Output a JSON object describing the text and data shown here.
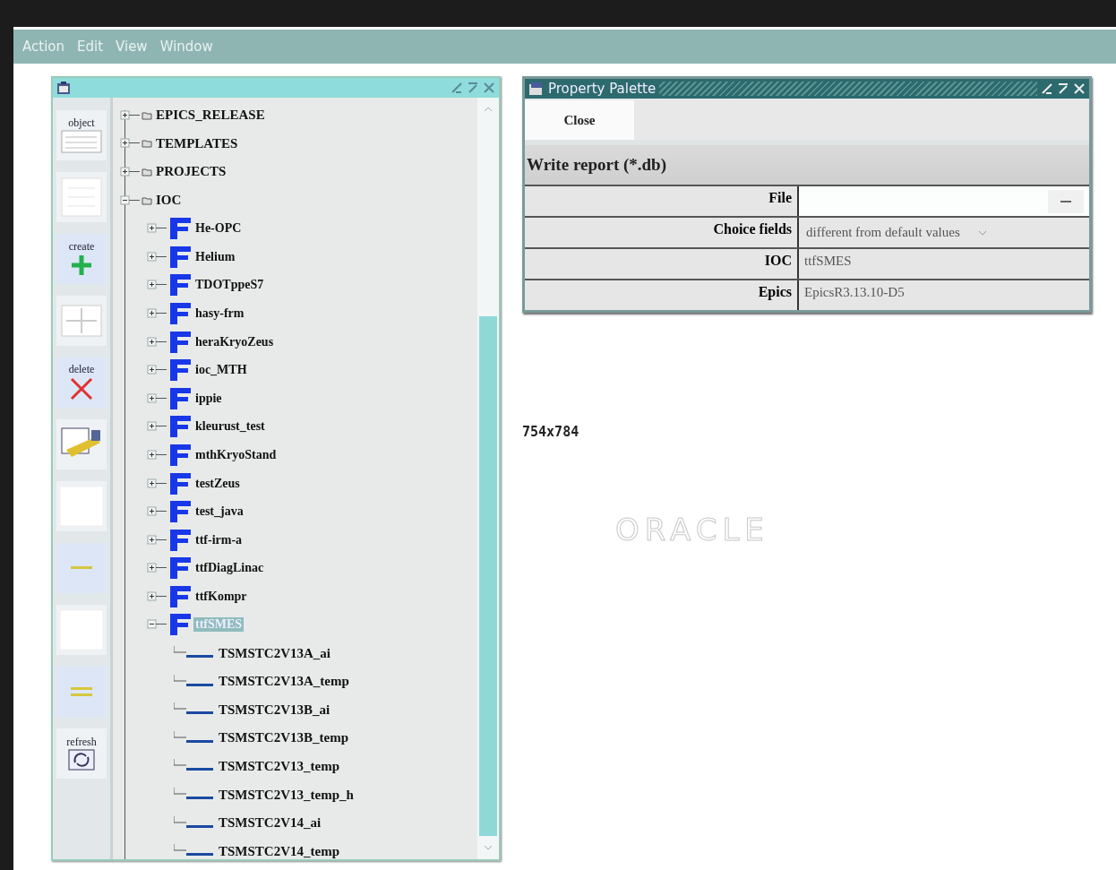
{
  "menu": [
    "Action",
    "Edit",
    "View",
    "Window"
  ],
  "navigator": {
    "toolbar": [
      {
        "kind": "list",
        "label": "object"
      },
      {
        "kind": "sheet"
      },
      {
        "kind": "create",
        "label": "create"
      },
      {
        "kind": "grid"
      },
      {
        "kind": "delete",
        "label": "delete"
      },
      {
        "kind": "report"
      },
      {
        "kind": "blank"
      },
      {
        "kind": "dash"
      },
      {
        "kind": "blank"
      },
      {
        "kind": "equal"
      },
      {
        "kind": "refresh",
        "label": "refresh"
      }
    ],
    "tree": [
      {
        "kind": "folder",
        "label": "EPICS_RELEASE",
        "expanded": false,
        "selected": false
      },
      {
        "kind": "folder",
        "label": "TEMPLATES",
        "expanded": false,
        "selected": false
      },
      {
        "kind": "folder",
        "label": "PROJECTS",
        "expanded": false,
        "selected": false
      },
      {
        "kind": "folder",
        "label": "IOC",
        "expanded": true,
        "selected": false,
        "children": [
          {
            "kind": "form",
            "label": "He-OPC",
            "expanded": false,
            "selected": false
          },
          {
            "kind": "form",
            "label": "Helium",
            "expanded": false,
            "selected": false
          },
          {
            "kind": "form",
            "label": "TDOTppeS7",
            "expanded": false,
            "selected": false
          },
          {
            "kind": "form",
            "label": "hasy-frm",
            "expanded": false,
            "selected": false
          },
          {
            "kind": "form",
            "label": "heraKryoZeus",
            "expanded": false,
            "selected": false
          },
          {
            "kind": "form",
            "label": "ioc_MTH",
            "expanded": false,
            "selected": false
          },
          {
            "kind": "form",
            "label": "ippie",
            "expanded": false,
            "selected": false
          },
          {
            "kind": "form",
            "label": "kleurust_test",
            "expanded": false,
            "selected": false
          },
          {
            "kind": "form",
            "label": "mthKryoStand",
            "expanded": false,
            "selected": false
          },
          {
            "kind": "form",
            "label": "testZeus",
            "expanded": false,
            "selected": false
          },
          {
            "kind": "form",
            "label": "test_java",
            "expanded": false,
            "selected": false
          },
          {
            "kind": "form",
            "label": "ttf-irm-a",
            "expanded": false,
            "selected": false
          },
          {
            "kind": "form",
            "label": "ttfDiagLinac",
            "expanded": false,
            "selected": false
          },
          {
            "kind": "form",
            "label": "ttfKompr",
            "expanded": false,
            "selected": false
          },
          {
            "kind": "form",
            "label": "ttfSMES",
            "expanded": true,
            "selected": true,
            "children": [
              {
                "kind": "record",
                "label": "TSMSTC2V13A_ai",
                "selected": false
              },
              {
                "kind": "record",
                "label": "TSMSTC2V13A_temp",
                "selected": false
              },
              {
                "kind": "record",
                "label": "TSMSTC2V13B_ai",
                "selected": false
              },
              {
                "kind": "record",
                "label": "TSMSTC2V13B_temp",
                "selected": false
              },
              {
                "kind": "record",
                "label": "TSMSTC2V13_temp",
                "selected": false
              },
              {
                "kind": "record",
                "label": "TSMSTC2V13_temp_h",
                "selected": false
              },
              {
                "kind": "record",
                "label": "TSMSTC2V14_ai",
                "selected": false
              },
              {
                "kind": "record",
                "label": "TSMSTC2V14_temp",
                "selected": false
              }
            ]
          }
        ]
      }
    ]
  },
  "property_palette": {
    "title": "Property Palette",
    "close_button": "Close",
    "section": "Write report (*.db)",
    "rows": [
      {
        "kind": "file",
        "label": "File"
      },
      {
        "kind": "select",
        "label": "Choice fields",
        "value": "different from default values"
      },
      {
        "kind": "text",
        "label": "IOC",
        "value": "ttfSMES"
      },
      {
        "kind": "text",
        "label": "Epics",
        "value": "EpicsR3.13.10-D5"
      }
    ]
  },
  "size_label": "754x784",
  "logo": "ORACLE"
}
